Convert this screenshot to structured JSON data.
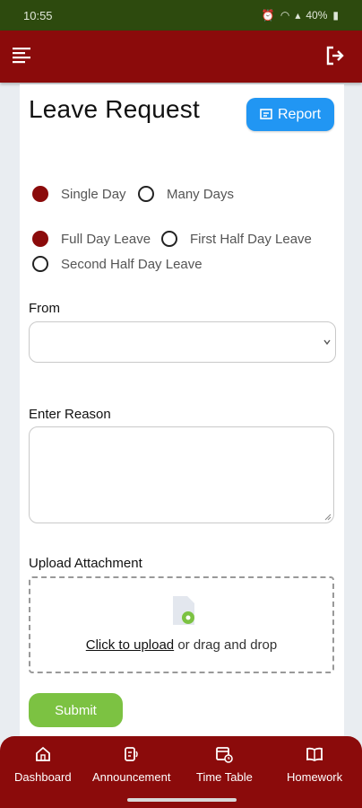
{
  "status_bar": {
    "time": "10:55",
    "battery": "40%"
  },
  "header": {
    "menu_icon": "menu-icon",
    "logout_icon": "logout-icon",
    "bg_color": "#8b0b0b"
  },
  "page": {
    "title": "Leave Request",
    "report_label": "Report"
  },
  "day_type": {
    "options": [
      "Single Day",
      "Many Days"
    ],
    "selected": "Single Day"
  },
  "leave_type": {
    "options": [
      "Full Day Leave",
      "First Half Day Leave",
      "Second Half Day Leave"
    ],
    "selected": "Full Day Leave"
  },
  "form": {
    "from_label": "From",
    "from_value": "",
    "reason_label": "Enter Reason",
    "reason_value": "",
    "upload_label": "Upload Attachment",
    "upload_link": "Click to upload",
    "upload_hint": " or drag and drop",
    "submit_label": "Submit"
  },
  "colors": {
    "accent_red": "#8b0b0b",
    "report_blue": "#2196f3",
    "submit_green": "#7cc242"
  },
  "bottom_nav": {
    "items": [
      {
        "label": "Dashboard",
        "icon": "home-icon"
      },
      {
        "label": "Announcement",
        "icon": "announcement-icon"
      },
      {
        "label": "Time Table",
        "icon": "timetable-icon"
      },
      {
        "label": "Homework",
        "icon": "book-icon"
      }
    ]
  }
}
